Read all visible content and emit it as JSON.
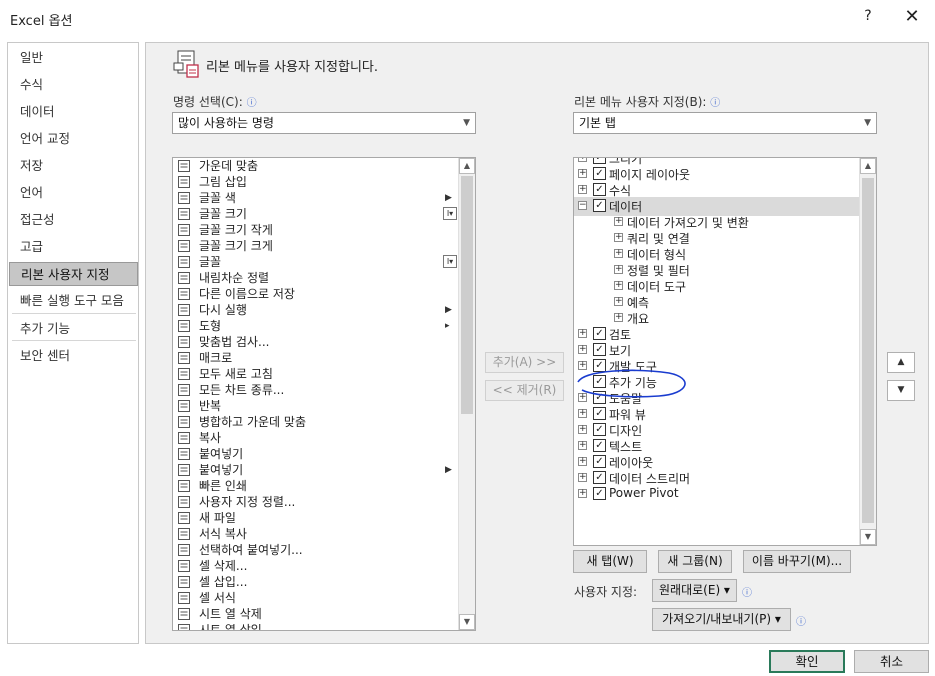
{
  "window": {
    "title": "Excel 옵션",
    "help_glyph": "?",
    "close_glyph": "✕"
  },
  "nav": {
    "items": [
      {
        "label": "일반"
      },
      {
        "label": "수식"
      },
      {
        "label": "데이터"
      },
      {
        "label": "언어 교정"
      },
      {
        "label": "저장"
      },
      {
        "label": "언어"
      },
      {
        "label": "접근성"
      },
      {
        "label": "고급"
      },
      {
        "label": "리본 사용자 지정",
        "selected": true
      },
      {
        "label": "빠른 실행 도구 모음"
      },
      {
        "label": "추가 기능"
      },
      {
        "label": "보안 센터"
      }
    ]
  },
  "header": {
    "text": "리본 메뉴를 사용자 지정합니다.",
    "icon": "customize-ribbon-icon"
  },
  "commands": {
    "label": "명령 선택(C):",
    "info": "ⓘ",
    "selected": "많이 사용하는 명령",
    "items": [
      {
        "label": "가운데 맞춤",
        "icon": "align-center-icon"
      },
      {
        "label": "그림 삽입",
        "icon": "insert-picture-icon"
      },
      {
        "label": "글꼴 색",
        "icon": "font-color-icon",
        "sub": "▶"
      },
      {
        "label": "글꼴 크기",
        "icon": "font-size-icon",
        "btn": "I▾"
      },
      {
        "label": "글꼴 크기 작게",
        "icon": "decrease-font-icon"
      },
      {
        "label": "글꼴 크기 크게",
        "icon": "increase-font-icon"
      },
      {
        "label": "글꼴",
        "icon": "font-icon",
        "btn": "I▾"
      },
      {
        "label": "내림차순 정렬",
        "icon": "sort-descending-icon"
      },
      {
        "label": "다른 이름으로 저장",
        "icon": "save-as-icon"
      },
      {
        "label": "다시 실행",
        "icon": "redo-icon",
        "sub": "▶"
      },
      {
        "label": "도형",
        "icon": "shapes-icon",
        "sub": "▸"
      },
      {
        "label": "맞춤법 검사...",
        "icon": "spelling-icon"
      },
      {
        "label": "매크로",
        "icon": "macro-icon"
      },
      {
        "label": "모두 새로 고침",
        "icon": "refresh-all-icon"
      },
      {
        "label": "모든 차트 종류...",
        "icon": "all-charts-icon"
      },
      {
        "label": "반복",
        "icon": "repeat-icon"
      },
      {
        "label": "병합하고 가운데 맞춤",
        "icon": "merge-center-icon"
      },
      {
        "label": "복사",
        "icon": "copy-icon"
      },
      {
        "label": "붙여넣기",
        "icon": "paste-icon"
      },
      {
        "label": "붙여넣기",
        "icon": "paste-icon",
        "sub": "▶"
      },
      {
        "label": "빠른 인쇄",
        "icon": "quick-print-icon"
      },
      {
        "label": "사용자 지정 정렬...",
        "icon": "custom-sort-icon"
      },
      {
        "label": "새 파일",
        "icon": "new-file-icon"
      },
      {
        "label": "서식 복사",
        "icon": "format-painter-icon"
      },
      {
        "label": "선택하여 붙여넣기...",
        "icon": "paste-special-icon"
      },
      {
        "label": "셀 삭제...",
        "icon": "delete-cells-icon"
      },
      {
        "label": "셀 삽입...",
        "icon": "insert-cells-icon"
      },
      {
        "label": "셀 서식",
        "icon": "format-cells-icon"
      },
      {
        "label": "시트 열 삭제",
        "icon": "delete-columns-icon"
      },
      {
        "label": "시트 열 삽입",
        "icon": "insert-columns-icon"
      }
    ]
  },
  "ribbon": {
    "label": "리본 메뉴 사용자 지정(B):",
    "info": "ⓘ",
    "selected": "기본 탭",
    "items": [
      {
        "label": "그리기",
        "level": 0,
        "expander": "+",
        "checked": true
      },
      {
        "label": "페이지 레이아웃",
        "level": 0,
        "expander": "+",
        "checked": true
      },
      {
        "label": "수식",
        "level": 0,
        "expander": "+",
        "checked": true
      },
      {
        "label": "데이터",
        "level": 0,
        "expander": "−",
        "checked": true,
        "selected": true
      },
      {
        "label": "데이터 가져오기 및 변환",
        "level": 1,
        "expander": "+"
      },
      {
        "label": "쿼리 및 연결",
        "level": 1,
        "expander": "+"
      },
      {
        "label": "데이터 형식",
        "level": 1,
        "expander": "+"
      },
      {
        "label": "정렬 및 필터",
        "level": 1,
        "expander": "+"
      },
      {
        "label": "데이터 도구",
        "level": 1,
        "expander": "+"
      },
      {
        "label": "예측",
        "level": 1,
        "expander": "+"
      },
      {
        "label": "개요",
        "level": 1,
        "expander": "+"
      },
      {
        "label": "검토",
        "level": 0,
        "expander": "+",
        "checked": true
      },
      {
        "label": "보기",
        "level": 0,
        "expander": "+",
        "checked": true
      },
      {
        "label": "개발 도구",
        "level": 0,
        "expander": "+",
        "checked": true,
        "annotated": true
      },
      {
        "label": "추가 기능",
        "level": 0,
        "expander": "",
        "checked": true
      },
      {
        "label": "도움말",
        "level": 0,
        "expander": "+",
        "checked": true
      },
      {
        "label": "파워 뷰",
        "level": 0,
        "expander": "+",
        "checked": true
      },
      {
        "label": "디자인",
        "level": 0,
        "expander": "+",
        "checked": true
      },
      {
        "label": "텍스트",
        "level": 0,
        "expander": "+",
        "checked": true
      },
      {
        "label": "레이아웃",
        "level": 0,
        "expander": "+",
        "checked": true
      },
      {
        "label": "데이터 스트리머",
        "level": 0,
        "expander": "+",
        "checked": true
      },
      {
        "label": "Power Pivot",
        "level": 0,
        "expander": "+",
        "checked": true
      }
    ]
  },
  "middle_buttons": {
    "add": "추가(A) >>",
    "remove": "<< 제거(R)"
  },
  "order_buttons": {
    "up": "▲",
    "down": "▼"
  },
  "bottom_buttons": {
    "new_tab": "새 탭(W)",
    "new_group": "새 그룹(N)",
    "rename": "이름 바꾸기(M)..."
  },
  "customizations": {
    "label": "사용자 지정:",
    "reset": "원래대로(E) ▾",
    "import_export": "가져오기/내보내기(P) ▾",
    "info": "ⓘ"
  },
  "dialog_buttons": {
    "ok": "확인",
    "cancel": "취소"
  },
  "colors": {
    "annotation": "#1a3ccf",
    "selected_nav": "#c6c6c6",
    "ok_border": "#2a7a5a"
  }
}
